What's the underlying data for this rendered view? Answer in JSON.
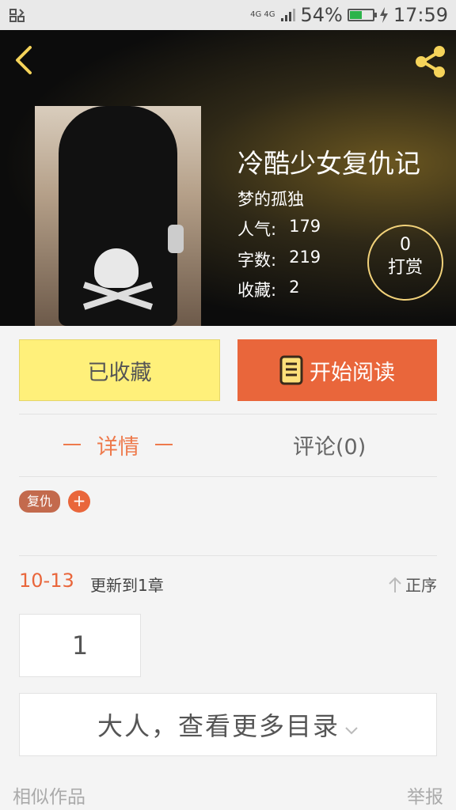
{
  "status_bar": {
    "network": "4G 4G",
    "battery_percent": "54%",
    "battery_level": 0.54,
    "time": "17:59",
    "icons": [
      "screen-icon",
      "signal-icon",
      "battery-icon",
      "charging-icon"
    ]
  },
  "header": {
    "back_icon": "chevron-left-icon",
    "share_icon": "share-icon",
    "book_title": "冷酷少女复仇记",
    "author": "梦的孤独",
    "stats": [
      {
        "label": "人气:",
        "value": "179"
      },
      {
        "label": "字数:",
        "value": "219"
      },
      {
        "label": "收藏:",
        "value": "2"
      }
    ],
    "reward": {
      "count": "0",
      "label": "打赏"
    }
  },
  "actions": {
    "favorite_label": "已收藏",
    "read_label": "开始阅读",
    "read_icon": "book-icon"
  },
  "tabs": {
    "detail": "详情",
    "comments": "评论(0)"
  },
  "tags": {
    "items": [
      "复仇"
    ],
    "add_label": "+"
  },
  "update": {
    "date": "10-13",
    "text": "更新到1章",
    "sort_label": "正序"
  },
  "chapters": [
    "1"
  ],
  "more_catalog": "大人，查看更多目录",
  "footer": {
    "similar": "相似作品",
    "report": "举报"
  },
  "colors": {
    "accent": "#e9663b",
    "favorite": "#fff07a",
    "reward_ring": "#f2d27a"
  }
}
